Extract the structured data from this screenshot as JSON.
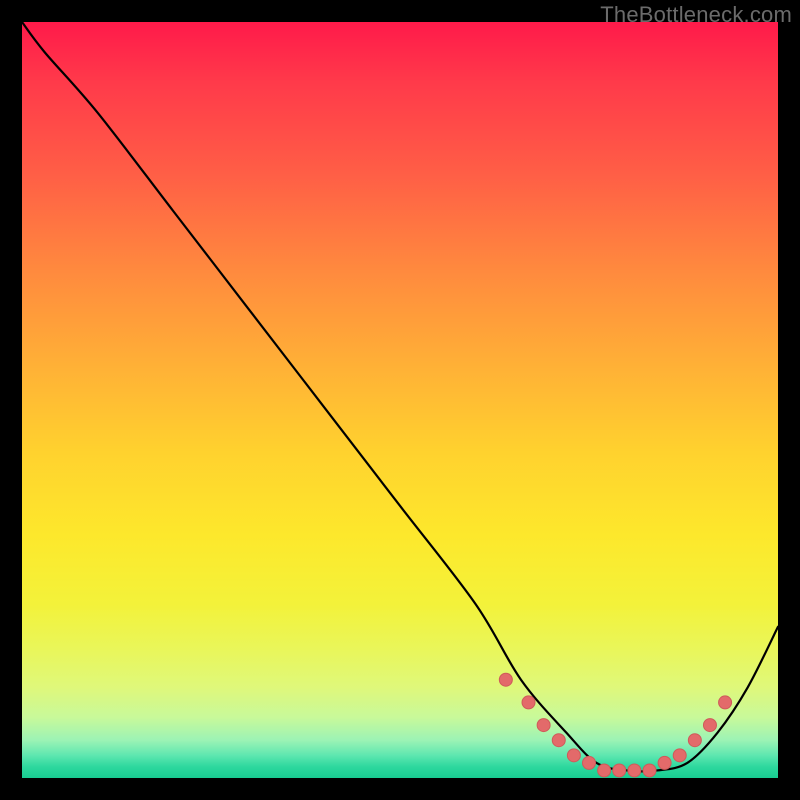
{
  "attribution": "TheBottleneck.com",
  "colors": {
    "curve_stroke": "#000000",
    "marker_fill": "#e36a6a",
    "marker_stroke": "#cf5a5a",
    "background": "#000000"
  },
  "chart_data": {
    "type": "line",
    "title": "",
    "xlabel": "",
    "ylabel": "",
    "xlim": [
      0,
      100
    ],
    "ylim": [
      0,
      100
    ],
    "series": [
      {
        "name": "bottleneck-curve",
        "x": [
          0,
          3,
          10,
          20,
          30,
          40,
          50,
          60,
          66,
          72,
          76,
          80,
          84,
          88,
          92,
          96,
          100
        ],
        "y": [
          100,
          96,
          88,
          75,
          62,
          49,
          36,
          23,
          13,
          6,
          2,
          1,
          1,
          2,
          6,
          12,
          20
        ]
      }
    ],
    "markers": {
      "name": "optimal-region",
      "x": [
        64,
        67,
        69,
        71,
        73,
        75,
        77,
        79,
        81,
        83,
        85,
        87,
        89,
        91,
        93
      ],
      "y": [
        13,
        10,
        7,
        5,
        3,
        2,
        1,
        1,
        1,
        1,
        2,
        3,
        5,
        7,
        10
      ]
    }
  }
}
